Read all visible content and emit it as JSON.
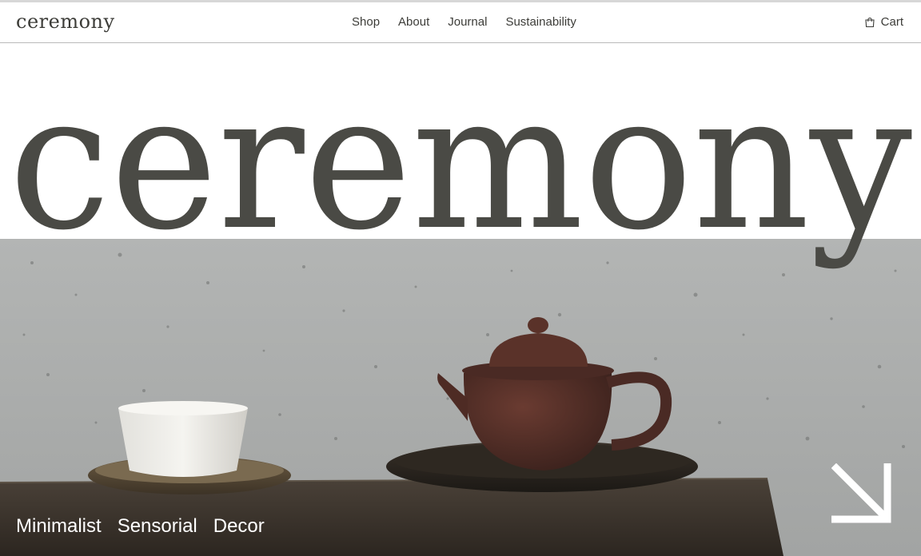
{
  "header": {
    "logo": "ceremony",
    "nav": [
      "Shop",
      "About",
      "Journal",
      "Sustainability"
    ],
    "cart_label": "Cart"
  },
  "hero": {
    "wordmark": "ceremony",
    "tags": [
      "Minimalist",
      "Sensorial",
      "Decor"
    ]
  },
  "icons": {
    "cart": "shopping-bag-icon",
    "arrow": "arrow-down-right-icon"
  },
  "colors": {
    "text": "#3c3c38",
    "hero_word": "#4a4a45",
    "white": "#ffffff"
  }
}
